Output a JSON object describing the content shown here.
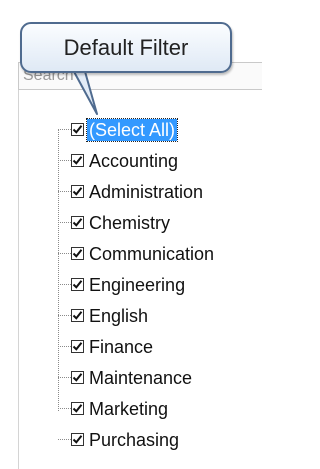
{
  "callout": {
    "text": "Default Filter"
  },
  "search": {
    "placeholder": "Search"
  },
  "items": [
    {
      "label": "(Select All)",
      "checked": true,
      "selected": true
    },
    {
      "label": "Accounting",
      "checked": true
    },
    {
      "label": "Administration",
      "checked": true
    },
    {
      "label": "Chemistry",
      "checked": true
    },
    {
      "label": "Communication",
      "checked": true
    },
    {
      "label": "Engineering",
      "checked": true
    },
    {
      "label": "English",
      "checked": true
    },
    {
      "label": "Finance",
      "checked": true
    },
    {
      "label": "Maintenance",
      "checked": true
    },
    {
      "label": "Marketing",
      "checked": true
    },
    {
      "label": "Purchasing",
      "checked": true
    }
  ],
  "colors": {
    "selection": "#3399ff",
    "callout_border": "#4f6b8f"
  },
  "icons": {
    "check": "check-icon"
  }
}
